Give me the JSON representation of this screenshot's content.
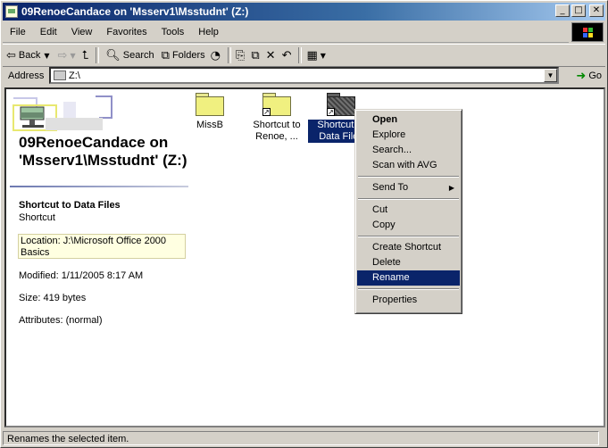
{
  "window": {
    "title": "09RenoeCandace on 'Msserv1\\Msstudnt' (Z:)"
  },
  "title_buttons": {
    "minimize": "_",
    "maximize": "□",
    "close": "✕"
  },
  "menu": [
    "File",
    "Edit",
    "View",
    "Favorites",
    "Tools",
    "Help"
  ],
  "toolbar": {
    "back": "Back",
    "search": "Search",
    "folders": "Folders"
  },
  "address": {
    "label": "Address",
    "value": "Z:\\",
    "go": "Go"
  },
  "drive": {
    "name": "09RenoeCandace on 'Msserv1\\Msstudnt' (Z:)"
  },
  "details": {
    "name": "Shortcut to Data Files",
    "type": "Shortcut",
    "location": "Location: J:\\Microsoft Office 2000 Basics",
    "modified": "Modified: 1/11/2005 8:17 AM",
    "size": "Size: 419 bytes",
    "attributes": "Attributes: (normal)"
  },
  "files": [
    {
      "label": "MissB"
    },
    {
      "label": "Shortcut to Renoe, ..."
    },
    {
      "label": "Shortcut to Data Files"
    }
  ],
  "context_menu": {
    "open": "Open",
    "explore": "Explore",
    "search": "Search...",
    "scan": "Scan with AVG",
    "send_to": "Send To",
    "cut": "Cut",
    "copy": "Copy",
    "create_shortcut": "Create Shortcut",
    "delete": "Delete",
    "rename": "Rename",
    "properties": "Properties"
  },
  "status": {
    "text": "Renames the selected item."
  },
  "colors": {
    "titlebar": "#0a246a",
    "selection": "#0a246a",
    "window_bg": "#d4d0c8"
  }
}
